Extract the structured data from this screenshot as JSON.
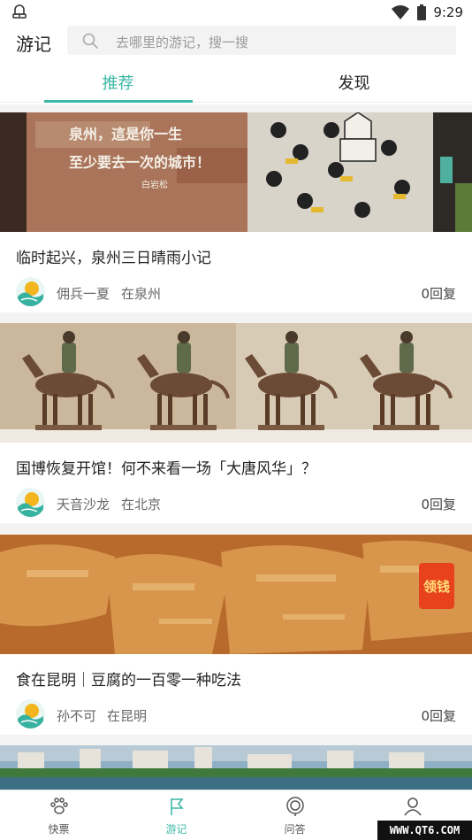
{
  "status_bar": {
    "time": "9:29"
  },
  "header": {
    "title": "游记",
    "search_placeholder": "去哪里的游记，搜一搜"
  },
  "tabs": [
    {
      "label": "推荐",
      "active": true
    },
    {
      "label": "发现",
      "active": false
    }
  ],
  "posts": [
    {
      "title": "临时起兴，泉州三日晴雨小记",
      "author": "佣兵一夏",
      "location": "在泉州",
      "replies": "0回复"
    },
    {
      "title": "国博恢复开馆！何不来看一场「大唐风华」？",
      "author": "天音沙龙",
      "location": "在北京",
      "replies": "0回复"
    },
    {
      "title": "食在昆明｜豆腐的一百零一种吃法",
      "author": "孙不可",
      "location": "在昆明",
      "replies": "0回复"
    }
  ],
  "image_text": {
    "mural_line1": "泉州，這是你一生",
    "mural_line2": "至少要去一次的城市！",
    "mural_sign": "白岩松",
    "badge": "领钱"
  },
  "bottom_nav": [
    {
      "label": "快票",
      "icon": "paw-icon",
      "active": false
    },
    {
      "label": "游记",
      "icon": "flag-icon",
      "active": true
    },
    {
      "label": "问答",
      "icon": "question-bubble-icon",
      "active": false
    },
    {
      "label": "我的",
      "icon": "user-icon",
      "active": false
    }
  ],
  "watermark": "WWW.QT6.COM",
  "colors": {
    "accent": "#3bb8a6",
    "feed_bg": "#f3f3f3"
  }
}
